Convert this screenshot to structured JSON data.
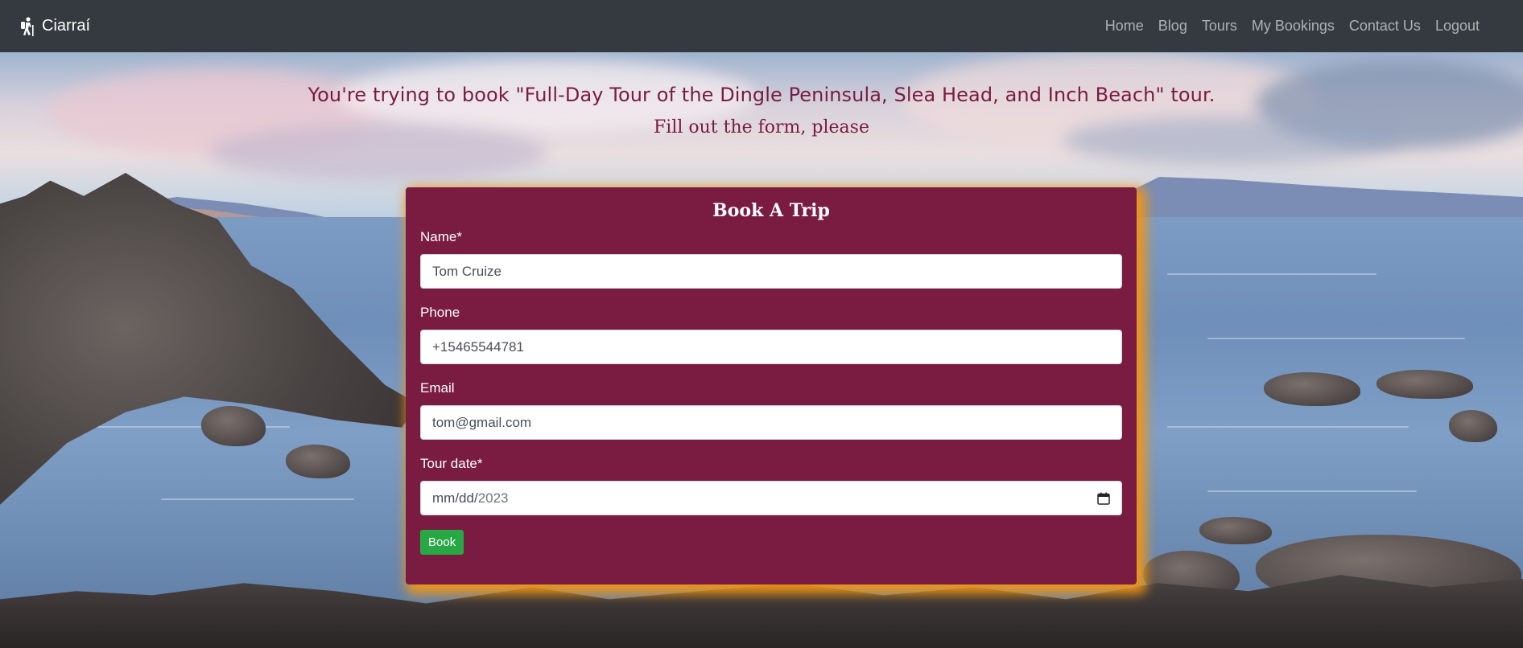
{
  "navbar": {
    "brand": "Ciarraí",
    "brand_icon": "hiker-icon",
    "links": [
      "Home",
      "Blog",
      "Tours",
      "My Bookings",
      "Contact Us",
      "Logout"
    ]
  },
  "header": {
    "title": "You're trying to book \"Full-Day Tour of the Dingle Peninsula, Slea Head, and Inch Beach\" tour.",
    "subtitle": "Fill out the form, please"
  },
  "form": {
    "title": "Book A Trip",
    "fields": [
      {
        "label": "Name*",
        "value": "Tom Cruize"
      },
      {
        "label": "Phone",
        "value": "+15465544781"
      },
      {
        "label": "Email",
        "value": "tom@gmail.com"
      }
    ],
    "date": {
      "label": "Tour date*",
      "placeholder": "mm/dd/",
      "year": "2023",
      "icon": "calendar-icon"
    },
    "submit_label": "Book"
  },
  "colors": {
    "navbar": "#343a40",
    "card": "#7a1c42",
    "card_glow": "#f0961a",
    "heading": "#7a1b40",
    "button": "#28a745"
  }
}
